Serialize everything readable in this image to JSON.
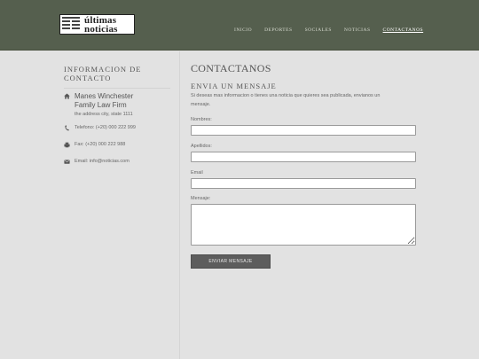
{
  "header": {
    "logo_line1": "últimas",
    "logo_line2": "noticias",
    "nav": [
      "INICIO",
      "DEPORTES",
      "SOCIALES",
      "NOTICIAS",
      "CONTACTANOS"
    ]
  },
  "sidebar": {
    "title_line1": "INFORMACION DE",
    "title_line2": "CONTACTO",
    "firm_line1": "Manes Winchester",
    "firm_line2": "Family Law Firm",
    "address": "the address city, state 1111",
    "phone": "Telefono: (+20) 000 222 999",
    "fax": "Fax: (+20) 000 222 988",
    "email": "Email: info@noticias.com"
  },
  "main": {
    "title": "CONTACTANOS",
    "subtitle": "ENVIA UN MENSAJE",
    "desc_line1": "Si deseas mas informacion o tienes una noticia que quieres sea publicada, envianos un",
    "desc_line2": "mensaje.",
    "label_nombres": "Nombres:",
    "label_apellidos": "Apellidos:",
    "label_email": "Email",
    "label_mensaje": "Mensaje:",
    "submit": "ENVIAR MENSAJE"
  }
}
